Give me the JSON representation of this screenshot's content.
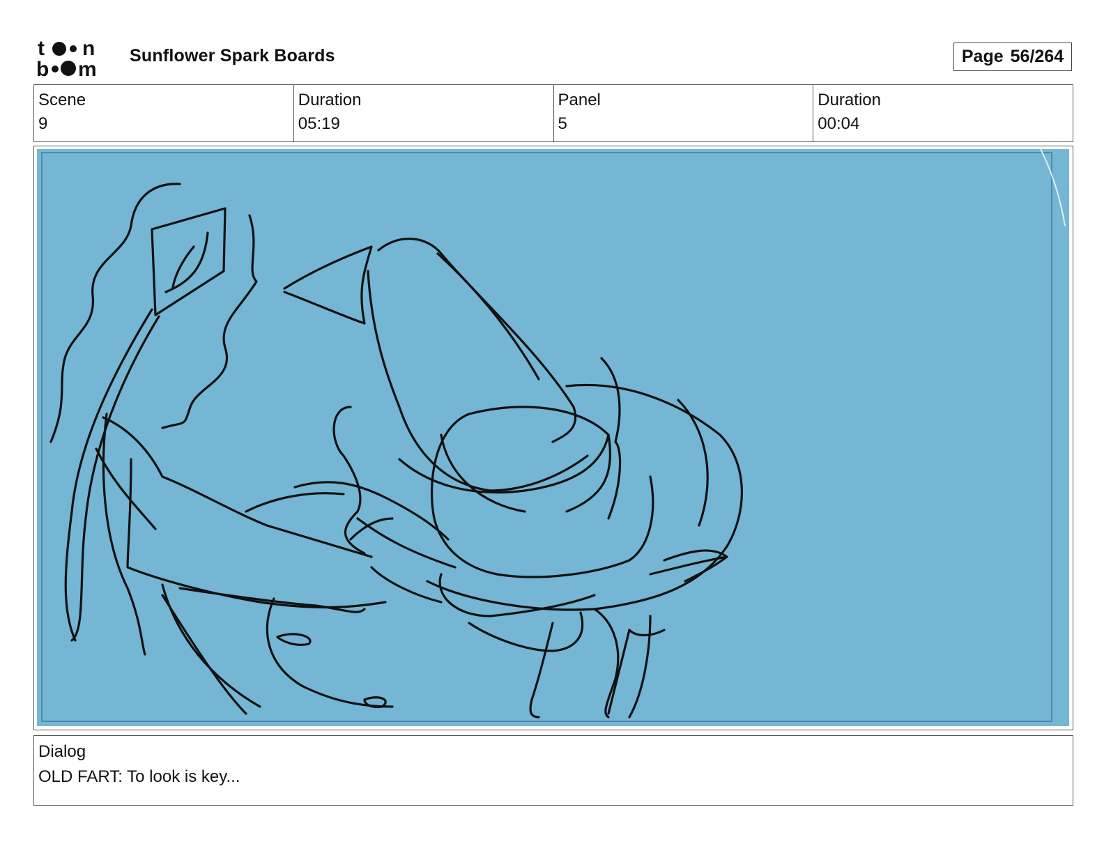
{
  "header": {
    "logo_text": "toonboom",
    "title": "Sunflower Spark Boards",
    "page_label": "Page",
    "page_value": "56/264"
  },
  "info": {
    "scene_label": "Scene",
    "scene_value": "9",
    "scene_duration_label": "Duration",
    "scene_duration_value": "05:19",
    "panel_label": "Panel",
    "panel_value": "5",
    "panel_duration_label": "Duration",
    "panel_duration_value": "00:04"
  },
  "panel": {
    "background_color": "#74b6d3",
    "stroke_color": "#111111"
  },
  "dialog": {
    "label": "Dialog",
    "text": "OLD FART: To look is key..."
  }
}
